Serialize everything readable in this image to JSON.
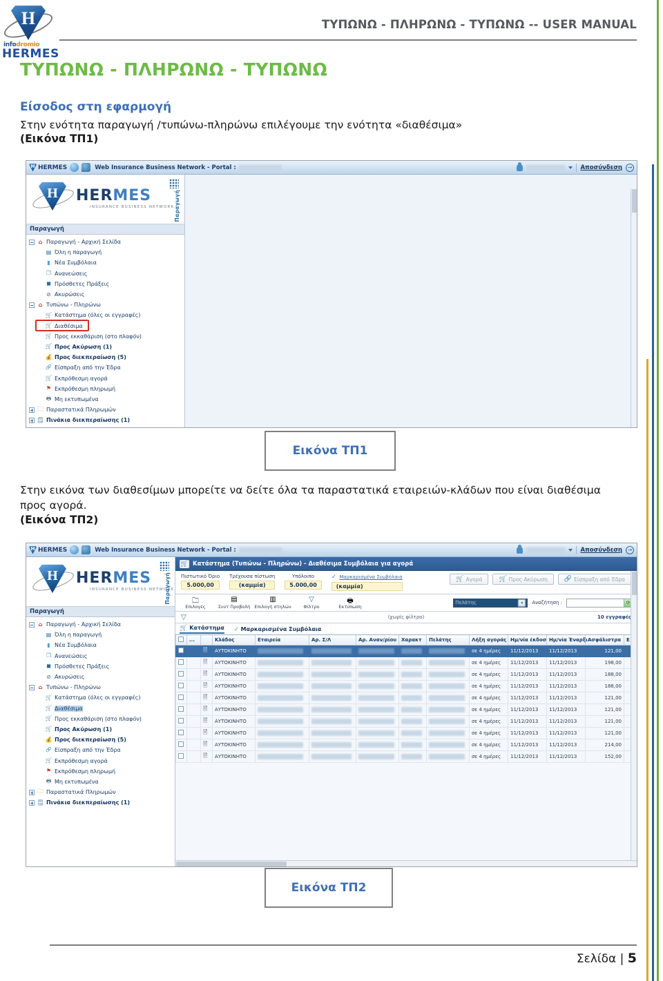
{
  "document": {
    "header_title": "ΤΥΠΩΝΩ - ΠΛΗΡΩΝΩ - ΤΥΠΩΝΩ -- USER MANUAL",
    "doc_title": "ΤΥΠΩΝΩ - ΠΛΗΡΩΝΩ - ΤΥΠΩΝΩ",
    "section_heading": "Είσοδος στη εφαρμογή",
    "paragraph_1": "Στην ενότητα παραγωγή /τυπώνω-πληρώνω επιλέγουμε την ενότητα «διαθέσιμα»",
    "paragraph_1_ref": "(Εικόνα ΤΠ1)",
    "paragraph_2": "Στην εικόνα των διαθεσίμων μπορείτε να δείτε όλα τα παραστατικά εταιρειών-κλάδων που είναι διαθέσιμα προς αγορά.",
    "paragraph_2_ref": "(Εικόνα ΤΠ2)",
    "caption_1": "Εικόνα ΤΠ1",
    "caption_2": "Εικόνα ΤΠ2",
    "footer_label": "Σελίδα |",
    "footer_page": "5",
    "brand": {
      "info_part1": "info",
      "info_part2": "dromio",
      "name": "HERMES",
      "shield_letter": "H"
    },
    "colors": {
      "title_green": "#6cbb45",
      "heading_blue": "#3e6fb5",
      "rule_gray": "#7b7f82",
      "edge_green": "#76a83e",
      "edge_blue": "#2e5f92",
      "edge_yellow": "#d9ab1b"
    }
  },
  "portal_bar": {
    "logo_text": "HERMES",
    "title": "Web Insurance Business Network - Portal :",
    "portal_value_redacted": true,
    "user_name_redacted": true,
    "logout_label": "Αποσύνδεση",
    "icons": [
      "hermes-shield-icon",
      "globe-icon",
      "chat-icon",
      "user-icon",
      "chevron-down-icon",
      "logout-icon"
    ]
  },
  "nav_banner": {
    "word_left": "HER",
    "word_right": "MES",
    "subtitle": "INSURANCE BUSINESS NETWORK",
    "vertical_label": "Παραγωγή",
    "grid_icon": "app-grid-icon"
  },
  "sidebar": {
    "section_label": "Παραγωγή",
    "items": [
      {
        "label": "Παραγωγή - Αρχική Σελίδα",
        "level": 1,
        "icon": "home-icon",
        "expander": "minus",
        "bold": false
      },
      {
        "label": "Όλη η παραγωγή",
        "level": 2,
        "icon": "list-icon",
        "bold": false
      },
      {
        "label": "Νέα Συμβόλαια",
        "level": 2,
        "icon": "document-icon",
        "bold": false
      },
      {
        "label": "Ανανεώσεις",
        "level": 2,
        "icon": "copy-icon",
        "bold": false
      },
      {
        "label": "Πρόσθετες Πράξεις",
        "level": 2,
        "icon": "square-icon",
        "bold": false
      },
      {
        "label": "Ακυρώσεις",
        "level": 2,
        "icon": "ban-icon",
        "bold": false
      },
      {
        "label": "Τυπώνω - Πληρώνω",
        "level": 1,
        "icon": "home-icon",
        "expander": "minus",
        "bold": false
      },
      {
        "label": "Κατάστημα (όλες οι εγγραφές)",
        "level": 2,
        "icon": "cart-clock-icon",
        "bold": false
      },
      {
        "label": "Διαθέσιμα",
        "level": 2,
        "icon": "cart-icon",
        "bold": false,
        "highlight": true
      },
      {
        "label": "Προς εκκαθάριση (στο πλαφόν)",
        "level": 2,
        "icon": "cart-green-icon",
        "bold": false
      },
      {
        "label": "Προς Ακύρωση (1)",
        "level": 2,
        "icon": "cart-orange-icon",
        "bold": true
      },
      {
        "label": "Προς διεκπεραίωση (5)",
        "level": 2,
        "icon": "money-icon",
        "bold": true
      },
      {
        "label": "Είσπραξη από την Έδρα",
        "level": 2,
        "icon": "clip-icon",
        "bold": false
      },
      {
        "label": "Εκπρόθεσμη αγορά",
        "level": 2,
        "icon": "cart-red-icon",
        "bold": false
      },
      {
        "label": "Εκπρόθεσμη πληρωμή",
        "level": 2,
        "icon": "flag-icon",
        "bold": false
      },
      {
        "label": "Μη εκτυπωμένα",
        "level": 2,
        "icon": "printer-icon",
        "bold": false
      },
      {
        "label": "Παραστατικά Πληρωμών",
        "level": 1,
        "icon": "folder-icon",
        "expander": "plus",
        "bold": false
      },
      {
        "label": "Πινάκια διεκπεραίωσης (1)",
        "level": 1,
        "icon": "board-icon",
        "expander": "plus",
        "bold": true
      }
    ]
  },
  "panel": {
    "title": "Κατάστημα (Τυπώνω - Πληρώνω) - Διαθέσιμα Συμβόλαια για αγορά",
    "title_icon": "cart-icon"
  },
  "credit_bar": {
    "fields": [
      {
        "label": "Πιστωτικό Όριο",
        "value": "5.000,00"
      },
      {
        "label": "Τρέχουσα πίστωση",
        "value": "(καμμία)"
      },
      {
        "label": "Υπόλοιπο",
        "value": "5.000,00"
      }
    ],
    "marked": {
      "link": "Μαρκαρισμένα Συμβόλαια",
      "value": "(καμμία)",
      "check_icon": "check-icon"
    },
    "buttons": [
      {
        "label": "Αγορά",
        "icon": "cart-buy-icon"
      },
      {
        "label": "Προς Ακύρωση",
        "icon": "cart-cancel-icon"
      },
      {
        "label": "Είσπραξη από Έδρα",
        "icon": "clip-icon"
      }
    ]
  },
  "toolbar": {
    "items": [
      {
        "label": "Επιλογές",
        "icon": "folder-icon"
      },
      {
        "label": "Συντ Προβολή",
        "icon": "table-icon"
      },
      {
        "label": "Επιλογή στηλών",
        "icon": "columns-icon"
      },
      {
        "label": "Φίλτρο",
        "icon": "funnel-icon"
      },
      {
        "label": "Εκτύπωση",
        "icon": "printer-icon"
      }
    ],
    "select_value": "Πελάτης",
    "search_label": "Αναζήτηση :",
    "search_value": "",
    "search_icon": "search-go-icon"
  },
  "filter_bar": {
    "funnel_icon": "funnel-icon",
    "status": "(χωρίς φίλτρο)",
    "record_count": "10 εγγραφές"
  },
  "grid_tabs": [
    {
      "label": "Κατάστημα",
      "icon": "cart-icon",
      "active": true
    },
    {
      "label": "Μαρκαρισμένα Συμβόλαια",
      "icon": "check-icon",
      "active": false
    }
  ],
  "table": {
    "columns": [
      "",
      "...",
      "",
      "Κλάδος",
      "Εταιρεία",
      "Αρ. Σ/Λ",
      "Αρ. Αναν/ρίου",
      "Χαρακτ",
      "Πελάτης",
      "Λήξη αγοράς",
      "Ημ/νία έκδοσ",
      "Ημ/νία Έναρξι",
      "Ασφάλιστρα",
      "Ε"
    ],
    "rows": [
      {
        "klados": "ΑΥΤΟΚΙΝΗΤΟ",
        "lixi": "σε 4 ημέρες",
        "ekdosi": "11/12/2013",
        "enarxi": "11/12/2013",
        "asfalistra": "121,00",
        "selected": true
      },
      {
        "klados": "ΑΥΤΟΚΙΝΗΤΟ",
        "lixi": "σε 4 ημέρες",
        "ekdosi": "11/12/2013",
        "enarxi": "11/12/2013",
        "asfalistra": "198,00",
        "selected": false
      },
      {
        "klados": "ΑΥΤΟΚΙΝΗΤΟ",
        "lixi": "σε 4 ημέρες",
        "ekdosi": "11/12/2013",
        "enarxi": "11/12/2013",
        "asfalistra": "188,00",
        "selected": false
      },
      {
        "klados": "ΑΥΤΟΚΙΝΗΤΟ",
        "lixi": "σε 4 ημέρες",
        "ekdosi": "11/12/2013",
        "enarxi": "11/12/2013",
        "asfalistra": "188,00",
        "selected": false
      },
      {
        "klados": "ΑΥΤΟΚΙΝΗΤΟ",
        "lixi": "σε 4 ημέρες",
        "ekdosi": "11/12/2013",
        "enarxi": "11/12/2013",
        "asfalistra": "121,00",
        "selected": false
      },
      {
        "klados": "ΑΥΤΟΚΙΝΗΤΟ",
        "lixi": "σε 4 ημέρες",
        "ekdosi": "11/12/2013",
        "enarxi": "11/12/2013",
        "asfalistra": "121,00",
        "selected": false
      },
      {
        "klados": "ΑΥΤΟΚΙΝΗΤΟ",
        "lixi": "σε 4 ημέρες",
        "ekdosi": "11/12/2013",
        "enarxi": "11/12/2013",
        "asfalistra": "121,00",
        "selected": false
      },
      {
        "klados": "ΑΥΤΟΚΙΝΗΤΟ",
        "lixi": "σε 4 ημέρες",
        "ekdosi": "11/12/2013",
        "enarxi": "11/12/2013",
        "asfalistra": "121,00",
        "selected": false
      },
      {
        "klados": "ΑΥΤΟΚΙΝΗΤΟ",
        "lixi": "σε 4 ημέρες",
        "ekdosi": "11/12/2013",
        "enarxi": "11/12/2013",
        "asfalistra": "214,00",
        "selected": false
      },
      {
        "klados": "ΑΥΤΟΚΙΝΗΤΟ",
        "lixi": "σε 4 ημέρες",
        "ekdosi": "11/12/2013",
        "enarxi": "11/12/2013",
        "asfalistra": "152,00",
        "selected": false
      }
    ]
  }
}
